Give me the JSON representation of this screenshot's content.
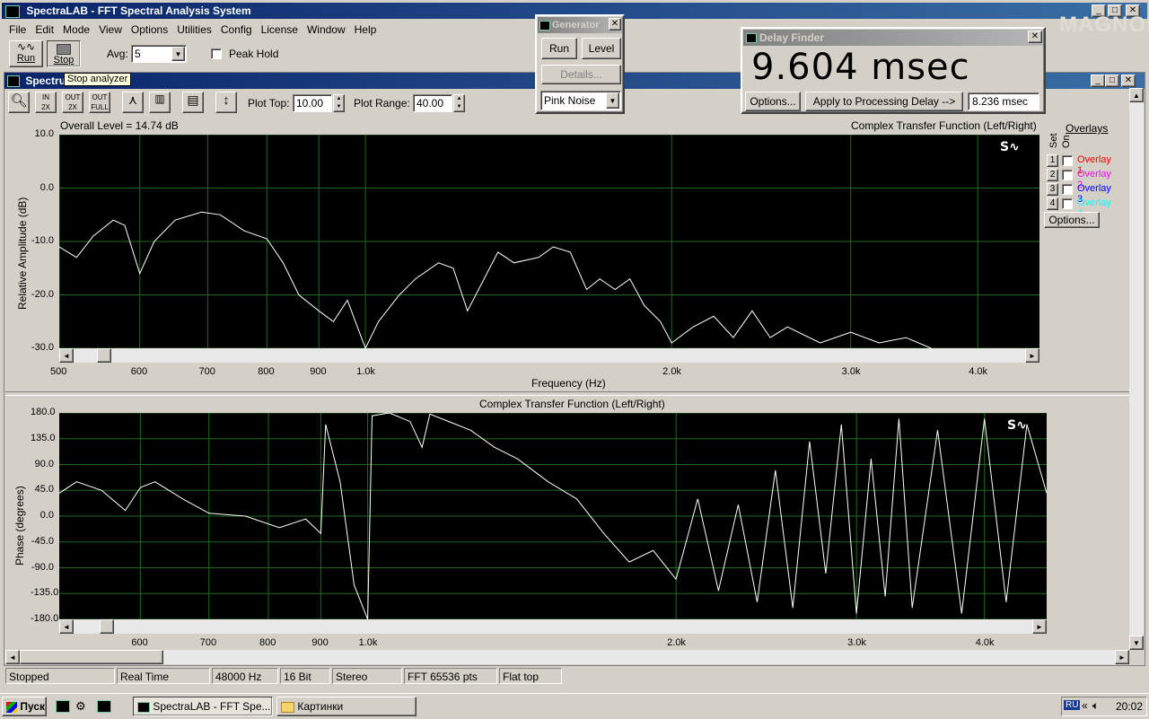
{
  "app": {
    "title": "SpectraLAB - FFT Spectral Analysis System"
  },
  "menu": [
    "File",
    "Edit",
    "Mode",
    "View",
    "Options",
    "Utilities",
    "Config",
    "License",
    "Window",
    "Help"
  ],
  "toolbar": {
    "run_label": "Run",
    "stop_label": "Stop",
    "avg_label": "Avg:",
    "avg_value": "5",
    "peak_hold_label": "Peak Hold",
    "tooltip": "Stop analyzer"
  },
  "spectrum_window": {
    "title": "Spectru",
    "plot_top_label": "Plot Top:",
    "plot_top_value": "10.00",
    "plot_range_label": "Plot Range:",
    "plot_range_value": "40.00"
  },
  "generator": {
    "title": "Generator",
    "run_label": "Run",
    "level_label": "Level",
    "details_label": "Details...",
    "noise_value": "Pink Noise"
  },
  "delay_finder": {
    "title": "Delay Finder",
    "value": "9.604 msec",
    "options_label": "Options...",
    "apply_label": "Apply to Processing Delay -->",
    "processing_value": "8.236 msec"
  },
  "watermark": "MAGNOLA",
  "overlays": {
    "title": "Overlays",
    "set_label": "Set",
    "on_label": "On",
    "options_label": "Options...",
    "items": [
      {
        "num": "1",
        "label": "Overlay 1",
        "color": "#ff0000"
      },
      {
        "num": "2",
        "label": "Overlay 2",
        "color": "#ff00ff"
      },
      {
        "num": "3",
        "label": "Overlay 3",
        "color": "#0000ff"
      },
      {
        "num": "4",
        "label": "Overlay 4",
        "color": "#00ffff"
      }
    ]
  },
  "chart_data": [
    {
      "type": "line",
      "title": "Complex Transfer Function (Left/Right)",
      "header_left": "Overall Level = 14.74 dB",
      "xlabel": "Frequency (Hz)",
      "ylabel": "Relative Amplitude (dB)",
      "xscale": "log",
      "xlim": [
        500,
        4600
      ],
      "ylim": [
        -30,
        10
      ],
      "x_ticks": [
        "500",
        "600",
        "700",
        "800",
        "900",
        "1.0k",
        "2.0k",
        "3.0k",
        "4.0k"
      ],
      "y_ticks": [
        "10.0",
        "0.0",
        "-10.0",
        "-20.0",
        "-30.0"
      ],
      "grid": true,
      "series": [
        {
          "color": "#ffffff",
          "points": [
            [
              500,
              -11
            ],
            [
              520,
              -13
            ],
            [
              540,
              -9
            ],
            [
              565,
              -6
            ],
            [
              580,
              -7
            ],
            [
              600,
              -16
            ],
            [
              620,
              -10
            ],
            [
              650,
              -6
            ],
            [
              690,
              -4.5
            ],
            [
              720,
              -5
            ],
            [
              760,
              -8
            ],
            [
              800,
              -9.5
            ],
            [
              830,
              -14
            ],
            [
              860,
              -20
            ],
            [
              900,
              -23
            ],
            [
              930,
              -25
            ],
            [
              960,
              -21
            ],
            [
              1000,
              -30
            ],
            [
              1030,
              -25
            ],
            [
              1080,
              -20
            ],
            [
              1120,
              -17
            ],
            [
              1180,
              -14
            ],
            [
              1220,
              -15
            ],
            [
              1260,
              -23
            ],
            [
              1300,
              -18
            ],
            [
              1350,
              -12
            ],
            [
              1400,
              -14
            ],
            [
              1480,
              -13
            ],
            [
              1530,
              -11
            ],
            [
              1590,
              -12
            ],
            [
              1650,
              -19
            ],
            [
              1700,
              -17
            ],
            [
              1760,
              -19
            ],
            [
              1820,
              -17
            ],
            [
              1880,
              -22
            ],
            [
              1950,
              -25
            ],
            [
              2000,
              -29
            ],
            [
              2100,
              -26
            ],
            [
              2200,
              -24
            ],
            [
              2300,
              -28
            ],
            [
              2400,
              -23
            ],
            [
              2500,
              -28
            ],
            [
              2600,
              -26
            ],
            [
              2800,
              -29
            ],
            [
              3000,
              -27
            ],
            [
              3200,
              -29
            ],
            [
              3400,
              -28
            ],
            [
              3600,
              -30
            ]
          ]
        }
      ]
    },
    {
      "type": "line",
      "title": "Complex Transfer Function (Left/Right)",
      "xlabel": "",
      "ylabel": "Phase (degrees)",
      "xscale": "log",
      "xlim": [
        500,
        4600
      ],
      "ylim": [
        -180,
        180
      ],
      "x_ticks": [
        "600",
        "700",
        "800",
        "900",
        "1.0k",
        "2.0k",
        "3.0k",
        "4.0k"
      ],
      "y_ticks": [
        "180.0",
        "135.0",
        "90.0",
        "45.0",
        "0.0",
        "-45.0",
        "-90.0",
        "-135.0",
        "-180.0"
      ],
      "grid": true,
      "series": [
        {
          "color": "#ffffff",
          "points": [
            [
              500,
              40
            ],
            [
              520,
              60
            ],
            [
              550,
              45
            ],
            [
              580,
              10
            ],
            [
              600,
              50
            ],
            [
              620,
              60
            ],
            [
              660,
              30
            ],
            [
              700,
              5
            ],
            [
              760,
              0
            ],
            [
              820,
              -20
            ],
            [
              870,
              -5
            ],
            [
              900,
              -30
            ],
            [
              910,
              160
            ],
            [
              940,
              60
            ],
            [
              970,
              -120
            ],
            [
              1000,
              -180
            ],
            [
              1010,
              175
            ],
            [
              1050,
              180
            ],
            [
              1100,
              165
            ],
            [
              1130,
              120
            ],
            [
              1150,
              178
            ],
            [
              1200,
              165
            ],
            [
              1260,
              150
            ],
            [
              1330,
              120
            ],
            [
              1400,
              100
            ],
            [
              1500,
              60
            ],
            [
              1600,
              30
            ],
            [
              1700,
              -30
            ],
            [
              1800,
              -80
            ],
            [
              1900,
              -60
            ],
            [
              2000,
              -110
            ],
            [
              2100,
              30
            ],
            [
              2200,
              -130
            ],
            [
              2300,
              20
            ],
            [
              2400,
              -150
            ],
            [
              2500,
              80
            ],
            [
              2600,
              -160
            ],
            [
              2700,
              130
            ],
            [
              2800,
              -100
            ],
            [
              2900,
              160
            ],
            [
              3000,
              -170
            ],
            [
              3100,
              100
            ],
            [
              3200,
              -140
            ],
            [
              3300,
              170
            ],
            [
              3400,
              -160
            ],
            [
              3600,
              150
            ],
            [
              3800,
              -170
            ],
            [
              4000,
              170
            ],
            [
              4200,
              -150
            ],
            [
              4400,
              160
            ],
            [
              4600,
              40
            ]
          ]
        }
      ]
    }
  ],
  "statusbar": [
    "Stopped",
    "Real Time",
    "48000 Hz",
    "16 Bit",
    "Stereo",
    "FFT 65536 pts",
    "Flat top"
  ],
  "taskbar": {
    "start_label": "Пуск",
    "task1": "SpectraLAB - FFT Spe...",
    "task2": "Картинки",
    "lang": "RU",
    "clock": "20:02"
  }
}
